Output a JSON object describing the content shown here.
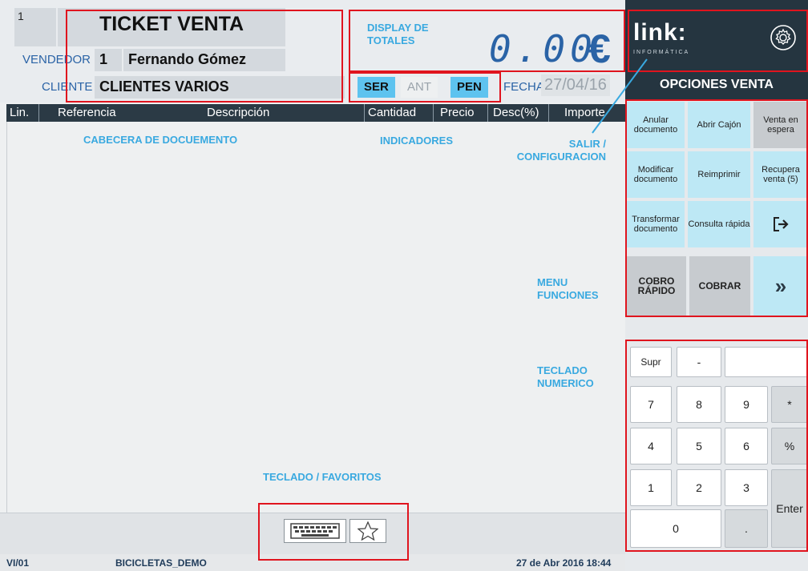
{
  "header": {
    "line_number": "1",
    "title": "TICKET VENTA",
    "seller_label": "VENDEDOR",
    "seller_id": "1",
    "seller_name": "Fernando Gómez",
    "client_label": "CLIENTE",
    "client_name": "CLIENTES VARIOS"
  },
  "totals": {
    "value": "0.00",
    "currency": "€"
  },
  "indicators": {
    "ser": "SER",
    "ant": "ANT",
    "pen": "PEN",
    "date_label": "FECHA",
    "date_value": "27/04/16"
  },
  "table": {
    "columns": [
      "Lin.",
      "Referencia",
      "Descripción",
      "Cantidad",
      "Precio",
      "Desc(%)",
      "Importe"
    ]
  },
  "annotations": {
    "display_totales": [
      "DISPLAY DE",
      "TOTALES"
    ],
    "cabecera": "CABECERA DE DOCUEMENTO",
    "indicadores": "INDICADORES",
    "salir": [
      "SALIR /",
      "CONFIGURACION"
    ],
    "menu": [
      "MENU",
      "FUNCIONES"
    ],
    "teclado": [
      "TECLADO",
      "NUMERICO"
    ],
    "favoritos": "TECLADO / FAVORITOS"
  },
  "brand": {
    "name": "link:",
    "sub": "INFORMÁTICA"
  },
  "options": {
    "title": "OPCIONES VENTA",
    "buttons": [
      "Anular documento",
      "Abrir Cajón",
      "Venta en espera",
      "Modificar documento",
      "Reimprimir",
      "Recupera venta (5)",
      "Transformar documento",
      "Consulta rápida",
      ""
    ],
    "cobro_rapido": "COBRO RÁPIDO",
    "cobrar": "COBRAR",
    "more": "»"
  },
  "keypad": {
    "supr": "Supr",
    "minus": "-",
    "star": "*",
    "percent": "%",
    "enter": "Enter",
    "dot": ".",
    "digits": [
      "7",
      "8",
      "9",
      "4",
      "5",
      "6",
      "1",
      "2",
      "3",
      "0"
    ],
    "input_value": ""
  },
  "status": {
    "code": "VI/01",
    "database": "BICICLETAS_DEMO",
    "datetime": "27 de Abr 2016 18:44"
  },
  "colors": {
    "accent": "#39a9e0",
    "highlight": "#e0141e",
    "dark": "#253540",
    "button": "#bde8f5"
  }
}
